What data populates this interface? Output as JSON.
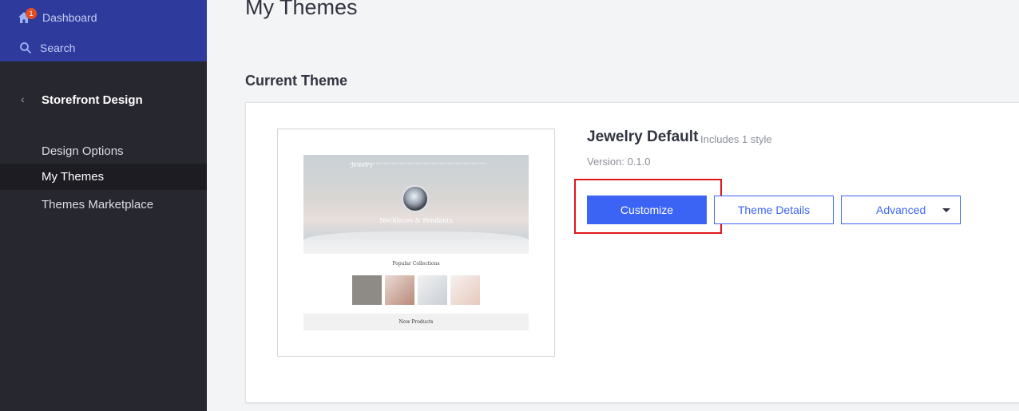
{
  "sidebar": {
    "top": {
      "dashboard_label": "Dashboard",
      "dashboard_badge": "1",
      "search_label": "Search"
    },
    "section_title": "Storefront Design",
    "items": [
      {
        "label": "Design Options",
        "active": false
      },
      {
        "label": "My Themes",
        "active": true
      },
      {
        "label": "Themes Marketplace",
        "active": false
      }
    ]
  },
  "main": {
    "page_title": "My Themes",
    "section_label": "Current Theme",
    "theme": {
      "name": "Jewelry Default",
      "styles": "Includes 1 style",
      "version": "Version: 0.1.0",
      "preview": {
        "logo_text": "Jewelry",
        "hero_text": "Necklaces & Pendants",
        "popular_title": "Popular Collections",
        "new_products": "New Products"
      }
    },
    "buttons": {
      "customize": "Customize",
      "theme_details": "Theme Details",
      "advanced": "Advanced"
    }
  },
  "colors": {
    "primary": "#3c64f4",
    "sidebar_bg": "#27272f",
    "sidebar_top_bg": "#2e3a9c",
    "highlight": "#e0161b",
    "badge": "#e04e24"
  }
}
